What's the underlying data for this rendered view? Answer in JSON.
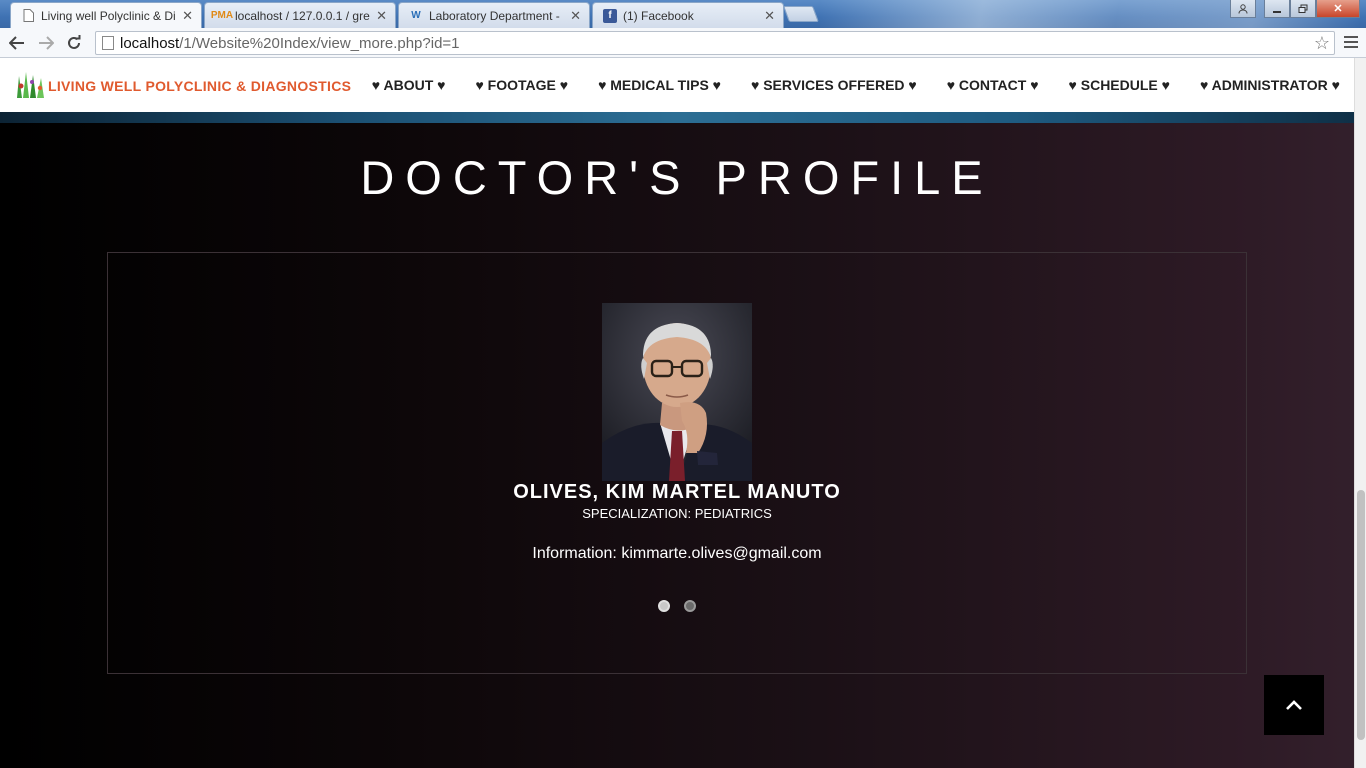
{
  "browser": {
    "tabs": [
      {
        "title": "Living well Polyclinic & Di",
        "icon": "page-icon",
        "active": true
      },
      {
        "title": "localhost / 127.0.0.1 / gre",
        "icon": "phpmyadmin-icon",
        "active": false
      },
      {
        "title": "Laboratory Department - ",
        "icon": "weebly-icon",
        "active": false
      },
      {
        "title": "(1) Facebook",
        "icon": "facebook-icon",
        "active": false
      }
    ],
    "url_host": "localhost",
    "url_path": "/1/Website%20Index/view_more.php?id=1"
  },
  "site": {
    "brand": "LIVING WELL POLYCLINIC & DIAGNOSTICS",
    "nav": [
      "♥ ABOUT ♥",
      "♥ FOOTAGE ♥",
      "♥ MEDICAL TIPS ♥",
      "♥ SERVICES OFFERED ♥",
      "♥ CONTACT ♥",
      "♥ SCHEDULE ♥",
      "♥ ADMINISTRATOR ♥"
    ]
  },
  "profile": {
    "section_title": "DOCTOR'S PROFILE",
    "name": "OLIVES, KIM MARTEL MANUTO",
    "specialization": "SPECIALIZATION: PEDIATRICS",
    "information": "Information: kimmarte.olives@gmail.com",
    "slides_total": 2,
    "slide_active": 1
  },
  "colors": {
    "brand": "#e05a2e",
    "header_bg": "#ffffff"
  }
}
